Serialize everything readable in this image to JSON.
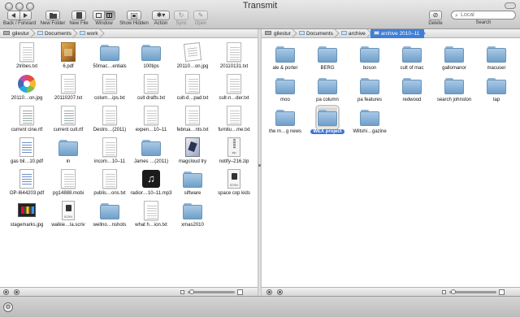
{
  "app": {
    "title": "Transmit"
  },
  "toolbar": {
    "back_forward": "Back / Forward",
    "new_folder": "New Folder",
    "new_file": "New File",
    "window": "Window",
    "show_hidden": "Show Hidden",
    "action": "Action",
    "sync": "Sync",
    "open": "Open",
    "delete": "Delete",
    "search_label": "Search",
    "search_placeholder": "Local"
  },
  "left": {
    "path": [
      "gilestur",
      "Documents",
      "work"
    ],
    "items": [
      {
        "label": "2tribes.txt",
        "icon": "doc"
      },
      {
        "label": "6.pdf",
        "icon": "pdf"
      },
      {
        "label": "50mac…entials",
        "icon": "folder"
      },
      {
        "label": "100tips",
        "icon": "folder"
      },
      {
        "label": "20110…on.jpg",
        "icon": "img"
      },
      {
        "label": "20110131.txt",
        "icon": "doc"
      },
      {
        "label": "20110…on.jpg",
        "icon": "picasa"
      },
      {
        "label": "20110207.txt",
        "icon": "doc"
      },
      {
        "label": "colum…ips.txt",
        "icon": "doc"
      },
      {
        "label": "cult drafts.txt",
        "icon": "doc"
      },
      {
        "label": "cult-d…pad.txt",
        "icon": "doc"
      },
      {
        "label": "cult-n…der.txt",
        "icon": "doc"
      },
      {
        "label": "current cine.rtf",
        "icon": "rtf"
      },
      {
        "label": "current cult.rtf",
        "icon": "rtf"
      },
      {
        "label": "Destro…(2011)",
        "icon": "doc"
      },
      {
        "label": "expen…10–11",
        "icon": "doc"
      },
      {
        "label": "februa…nts.txt",
        "icon": "doc"
      },
      {
        "label": "furnitu…me.txt",
        "icon": "doc"
      },
      {
        "label": "gas bil…10.pdf",
        "icon": "blue"
      },
      {
        "label": "in",
        "icon": "folder"
      },
      {
        "label": "incom…10–11",
        "icon": "doc"
      },
      {
        "label": "James …(2011)",
        "icon": "folder"
      },
      {
        "label": "magcloud try",
        "icon": "magcloud"
      },
      {
        "label": "notify–216.zip",
        "icon": "zip"
      },
      {
        "label": "OP-I644203.pdf",
        "icon": "blue"
      },
      {
        "label": "pg14888.mobi",
        "icon": "doc"
      },
      {
        "label": "publis…ons.txt",
        "icon": "doc"
      },
      {
        "label": "radior…10–11.mp3",
        "icon": "mp3"
      },
      {
        "label": "siftware",
        "icon": "folder"
      },
      {
        "label": "space cop kids",
        "icon": "scriv"
      },
      {
        "label": "stagemarks.jpg",
        "icon": "stage"
      },
      {
        "label": "walkie…la.scriv",
        "icon": "scriv"
      },
      {
        "label": "wellno…nshots",
        "icon": "folder"
      },
      {
        "label": "what h…ion.txt",
        "icon": "doc"
      },
      {
        "label": "xmas2010",
        "icon": "folder"
      }
    ]
  },
  "right": {
    "path": [
      "gilestur",
      "Documents",
      "archive",
      "archive 2010–11"
    ],
    "items": [
      {
        "label": "ale & porter",
        "icon": "folder"
      },
      {
        "label": "BERG",
        "icon": "folder"
      },
      {
        "label": "boson",
        "icon": "folder"
      },
      {
        "label": "cult of mac",
        "icon": "folder"
      },
      {
        "label": "gallomanor",
        "icon": "folder"
      },
      {
        "label": "macuser",
        "icon": "folder"
      },
      {
        "label": "moo",
        "icon": "folder"
      },
      {
        "label": "pa column",
        "icon": "folder"
      },
      {
        "label": "pa features",
        "icon": "folder"
      },
      {
        "label": "redwood",
        "icon": "folder"
      },
      {
        "label": "search johnston",
        "icon": "folder"
      },
      {
        "label": "tap",
        "icon": "folder"
      },
      {
        "label": "the m…g news",
        "icon": "folder"
      },
      {
        "label": "WEX project",
        "icon": "folder",
        "selected": true
      },
      {
        "label": "Wiltshi…gazine",
        "icon": "folder"
      }
    ]
  },
  "colors": {
    "accent": "#3875d7",
    "folder": "#7fa9d0"
  }
}
